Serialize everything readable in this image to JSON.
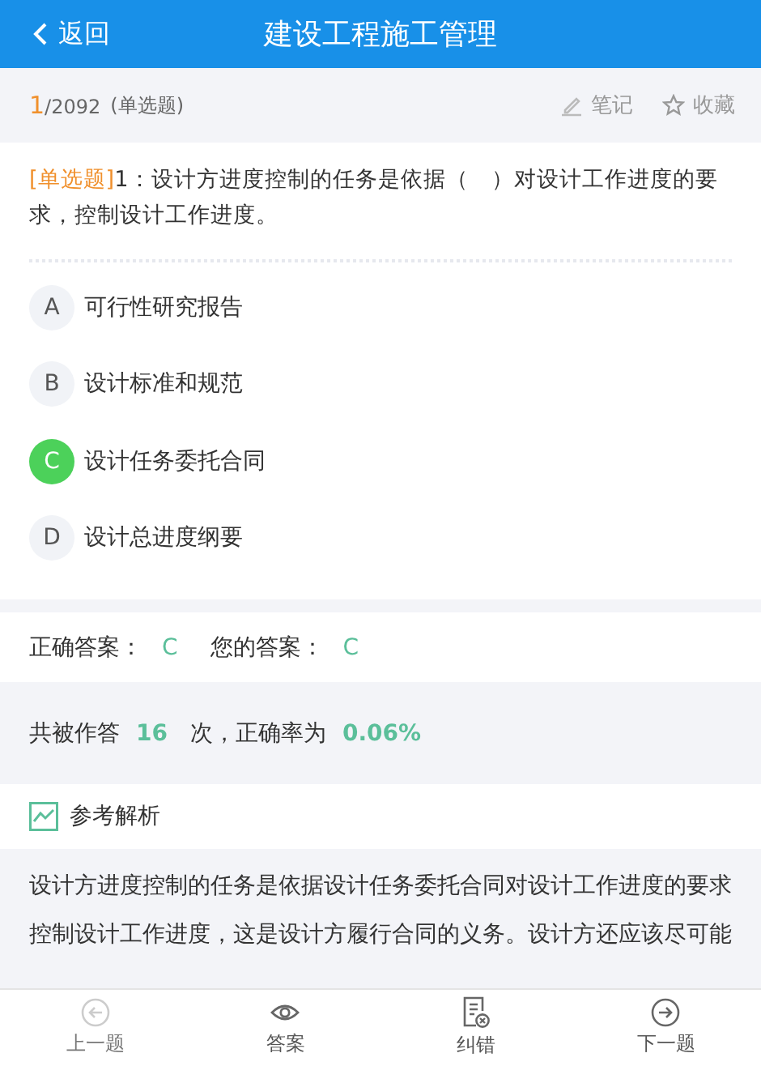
{
  "header": {
    "back": "返回",
    "title": "建设工程施工管理"
  },
  "meta": {
    "current": "1",
    "total": "/2092",
    "type": "(单选题)",
    "note": "笔记",
    "favorite": "收藏"
  },
  "question": {
    "tag": "[单选题]",
    "body": "1：设计方进度控制的任务是依据（　）对设计工作进度的要求，控制设计工作进度。"
  },
  "options": [
    {
      "letter": "A",
      "text": "可行性研究报告",
      "selected": false
    },
    {
      "letter": "B",
      "text": "设计标准和规范",
      "selected": false
    },
    {
      "letter": "C",
      "text": "设计任务委托合同",
      "selected": true
    },
    {
      "letter": "D",
      "text": "设计总进度纲要",
      "selected": false
    }
  ],
  "answer": {
    "correct_label": "正确答案：",
    "correct": "C",
    "yours_label": "您的答案：",
    "yours": "C"
  },
  "stats": {
    "prefix": "共被作答",
    "count": "16",
    "middle": "次，正确率为",
    "rate": "0.06%"
  },
  "analysis": {
    "title": "参考解析",
    "text": "设计方进度控制的任务是依据设计任务委托合同对设计工作进度的要求控制设计工作进度，这是设计方履行合同的义务。设计方还应该尽可能"
  },
  "bottom_nav": [
    {
      "kind": "prev",
      "label": "上一题",
      "disabled": true
    },
    {
      "kind": "answer",
      "label": "答案",
      "disabled": false
    },
    {
      "kind": "report",
      "label": "纠错",
      "disabled": false
    },
    {
      "kind": "next",
      "label": "下一题",
      "disabled": false
    }
  ]
}
